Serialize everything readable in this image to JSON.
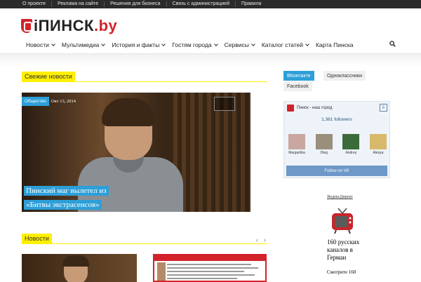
{
  "topbar": {
    "links": [
      "О проекте",
      "Реклама на сайте",
      "Решения для бизнеса",
      "Связь с администрацией",
      "Правила"
    ]
  },
  "logo": {
    "main": "ПИНСК",
    "suffix": ".by",
    "prefix": "i"
  },
  "nav": {
    "items": [
      {
        "label": "Новости",
        "dropdown": true
      },
      {
        "label": "Мультимедиа",
        "dropdown": true
      },
      {
        "label": "История и факты",
        "dropdown": true
      },
      {
        "label": "Гостям города",
        "dropdown": true
      },
      {
        "label": "Сервисы",
        "dropdown": true
      },
      {
        "label": "Каталог статей",
        "dropdown": true
      },
      {
        "label": "Карта Пинска",
        "dropdown": false
      }
    ],
    "search_icon": "search-icon"
  },
  "fresh": {
    "heading": "Свежие  новости",
    "featured": {
      "category": "Общество",
      "date": "Окт 13, 2014",
      "title": "Пинский маг вылетел из «Битвы экстрасенсов»"
    }
  },
  "news": {
    "heading": "Новости",
    "prev": "‹",
    "next": "›"
  },
  "sidebar": {
    "tabs": [
      "ВКонтакте",
      "Одноклассники",
      "Facebook"
    ],
    "vk": {
      "group_name": "Пинск - наш город",
      "followers": "1,361 followers",
      "members": [
        "Margaritka",
        "Oleg",
        "Andrey",
        "Alesya"
      ],
      "follow_label": "Follow on VK",
      "vk_logo": "В"
    },
    "ad": {
      "label": "ЯндексДирект",
      "title": "160 русских каналов в Герман",
      "sub": "Смотрите 160"
    }
  },
  "colors": {
    "accent_yellow": "#ffef00",
    "brand_red": "#d2232a",
    "blue": "#2d9fd8"
  }
}
